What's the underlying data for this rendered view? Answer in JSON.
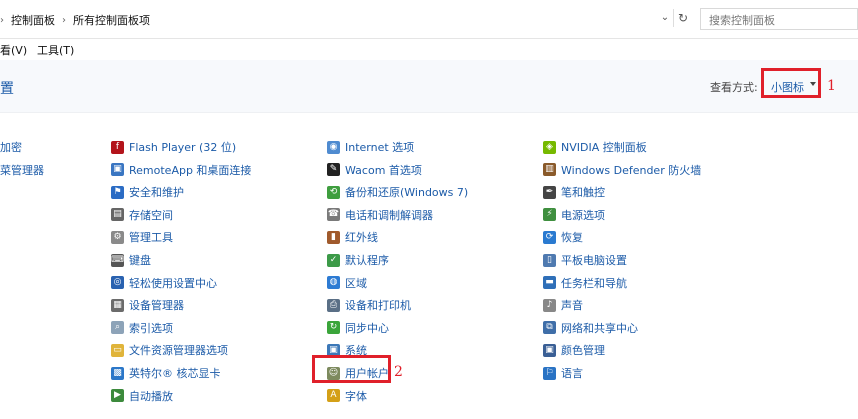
{
  "address": {
    "crumbs": [
      "控制面板",
      "所有控制面板项"
    ],
    "search_placeholder": "搜索控制面板"
  },
  "menu": {
    "view": "看(V)",
    "tools": "工具(T)"
  },
  "header": {
    "title": "置",
    "view_by_label": "查看方式:",
    "view_by_value": "小图标",
    "annot1": "1",
    "annot2": "2"
  },
  "columns": [
    {
      "items": [
        {
          "label": "加密",
          "icon": "bitlocker-icon",
          "color": "#7a7a7a"
        },
        {
          "label": "菜管理器",
          "icon": "credential-manager-icon",
          "color": "#c9a227"
        }
      ]
    },
    {
      "items": [
        {
          "label": "Flash Player (32 位)",
          "icon": "flash-icon",
          "color": "#b3141b",
          "glyph": "f"
        },
        {
          "label": "RemoteApp 和桌面连接",
          "icon": "remoteapp-icon",
          "color": "#3a76c2",
          "glyph": "▣"
        },
        {
          "label": "安全和维护",
          "icon": "flag-icon",
          "color": "#2b6cc4",
          "glyph": "⚑"
        },
        {
          "label": "存储空间",
          "icon": "storage-icon",
          "color": "#666666",
          "glyph": "▤"
        },
        {
          "label": "管理工具",
          "icon": "admin-tools-icon",
          "color": "#8a8a8a",
          "glyph": "⚙"
        },
        {
          "label": "键盘",
          "icon": "keyboard-icon",
          "color": "#555555",
          "glyph": "⌨"
        },
        {
          "label": "轻松使用设置中心",
          "icon": "ease-of-access-icon",
          "color": "#2a62b0",
          "glyph": "◎"
        },
        {
          "label": "设备管理器",
          "icon": "device-manager-icon",
          "color": "#6b6b6b",
          "glyph": "▦"
        },
        {
          "label": "索引选项",
          "icon": "indexing-icon",
          "color": "#8da3b8",
          "glyph": "⌕"
        },
        {
          "label": "文件资源管理器选项",
          "icon": "folder-options-icon",
          "color": "#e0b43a",
          "glyph": "▭"
        },
        {
          "label": "英特尔® 核芯显卡",
          "icon": "intel-graphics-icon",
          "color": "#2b77c8",
          "glyph": "▩"
        },
        {
          "label": "自动播放",
          "icon": "autoplay-icon",
          "color": "#3c8a3c",
          "glyph": "▶"
        }
      ]
    },
    {
      "items": [
        {
          "label": "Internet 选项",
          "icon": "internet-options-icon",
          "color": "#4f8bd0",
          "glyph": "◉"
        },
        {
          "label": "Wacom 首选项",
          "icon": "wacom-icon",
          "color": "#222222",
          "glyph": "✎"
        },
        {
          "label": "备份和还原(Windows 7)",
          "icon": "backup-restore-icon",
          "color": "#3f9e3f",
          "glyph": "⟲"
        },
        {
          "label": "电话和调制解调器",
          "icon": "phone-modem-icon",
          "color": "#7a7a7a",
          "glyph": "☎"
        },
        {
          "label": "红外线",
          "icon": "infrared-icon",
          "color": "#a05a2c",
          "glyph": "▮"
        },
        {
          "label": "默认程序",
          "icon": "default-programs-icon",
          "color": "#3c9a48",
          "glyph": "✓"
        },
        {
          "label": "区域",
          "icon": "region-icon",
          "color": "#2d7bd3",
          "glyph": "◍"
        },
        {
          "label": "设备和打印机",
          "icon": "printer-icon",
          "color": "#5a6f86",
          "glyph": "⎙"
        },
        {
          "label": "同步中心",
          "icon": "sync-center-icon",
          "color": "#3aa53a",
          "glyph": "↻"
        },
        {
          "label": "系统",
          "icon": "system-icon",
          "color": "#3c78b8",
          "glyph": "▣"
        },
        {
          "label": "用户帐户",
          "icon": "user-accounts-icon",
          "color": "#7d8a5e",
          "glyph": "☺"
        },
        {
          "label": "字体",
          "icon": "fonts-icon",
          "color": "#d4a017",
          "glyph": "A"
        }
      ]
    },
    {
      "items": [
        {
          "label": "NVIDIA 控制面板",
          "icon": "nvidia-icon",
          "color": "#76b900",
          "glyph": "◈"
        },
        {
          "label": "Windows Defender 防火墙",
          "icon": "firewall-icon",
          "color": "#8a5a2a",
          "glyph": "▥"
        },
        {
          "label": "笔和触控",
          "icon": "pen-touch-icon",
          "color": "#444444",
          "glyph": "✒"
        },
        {
          "label": "电源选项",
          "icon": "power-options-icon",
          "color": "#3f8f3f",
          "glyph": "⚡"
        },
        {
          "label": "恢复",
          "icon": "recovery-icon",
          "color": "#2a7ad0",
          "glyph": "⟳"
        },
        {
          "label": "平板电脑设置",
          "icon": "tablet-settings-icon",
          "color": "#4f7ab0",
          "glyph": "▯"
        },
        {
          "label": "任务栏和导航",
          "icon": "taskbar-icon",
          "color": "#2f6fb8",
          "glyph": "▬"
        },
        {
          "label": "声音",
          "icon": "sound-icon",
          "color": "#888888",
          "glyph": "♪"
        },
        {
          "label": "网络和共享中心",
          "icon": "network-icon",
          "color": "#3f6ea8",
          "glyph": "⧉"
        },
        {
          "label": "颜色管理",
          "icon": "color-management-icon",
          "color": "#3a5f95",
          "glyph": "▣"
        },
        {
          "label": "语言",
          "icon": "language-icon",
          "color": "#2a73c4",
          "glyph": "⚐"
        }
      ]
    }
  ]
}
